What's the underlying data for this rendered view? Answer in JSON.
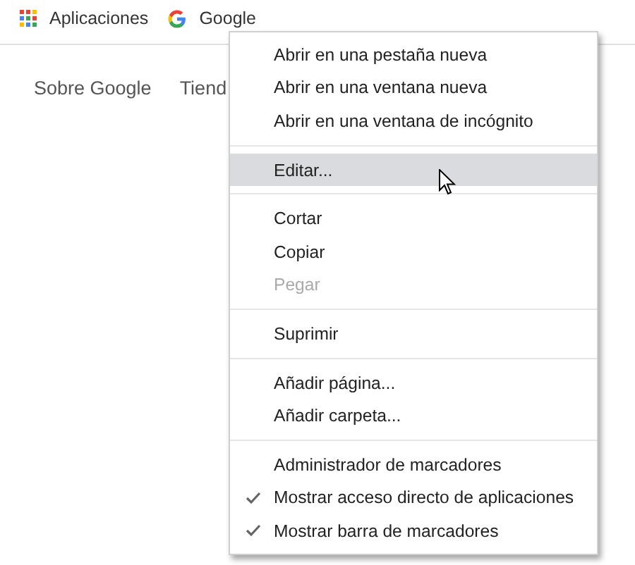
{
  "bookmarks_bar": {
    "items": [
      {
        "kind": "apps",
        "label": "Aplicaciones"
      },
      {
        "kind": "google",
        "label": "Google"
      }
    ]
  },
  "page_links": [
    "Sobre Google",
    "Tiend"
  ],
  "context_menu": {
    "items": [
      {
        "kind": "item",
        "label": "Abrir en una pestaña nueva",
        "selected": false,
        "disabled": false,
        "checked": false
      },
      {
        "kind": "item",
        "label": "Abrir en una ventana nueva",
        "selected": false,
        "disabled": false,
        "checked": false
      },
      {
        "kind": "item",
        "label": "Abrir en una ventana de incógnito",
        "selected": false,
        "disabled": false,
        "checked": false
      },
      {
        "kind": "separator"
      },
      {
        "kind": "item",
        "label": "Editar...",
        "selected": true,
        "disabled": false,
        "checked": false
      },
      {
        "kind": "separator"
      },
      {
        "kind": "item",
        "label": "Cortar",
        "selected": false,
        "disabled": false,
        "checked": false
      },
      {
        "kind": "item",
        "label": "Copiar",
        "selected": false,
        "disabled": false,
        "checked": false
      },
      {
        "kind": "item",
        "label": "Pegar",
        "selected": false,
        "disabled": true,
        "checked": false
      },
      {
        "kind": "separator"
      },
      {
        "kind": "item",
        "label": "Suprimir",
        "selected": false,
        "disabled": false,
        "checked": false
      },
      {
        "kind": "separator"
      },
      {
        "kind": "item",
        "label": "Añadir página...",
        "selected": false,
        "disabled": false,
        "checked": false
      },
      {
        "kind": "item",
        "label": "Añadir carpeta...",
        "selected": false,
        "disabled": false,
        "checked": false
      },
      {
        "kind": "separator"
      },
      {
        "kind": "item",
        "label": "Administrador de marcadores",
        "selected": false,
        "disabled": false,
        "checked": false
      },
      {
        "kind": "item",
        "label": "Mostrar acceso directo de aplicaciones",
        "selected": false,
        "disabled": false,
        "checked": true
      },
      {
        "kind": "item",
        "label": "Mostrar barra de marcadores",
        "selected": false,
        "disabled": false,
        "checked": true
      }
    ]
  }
}
